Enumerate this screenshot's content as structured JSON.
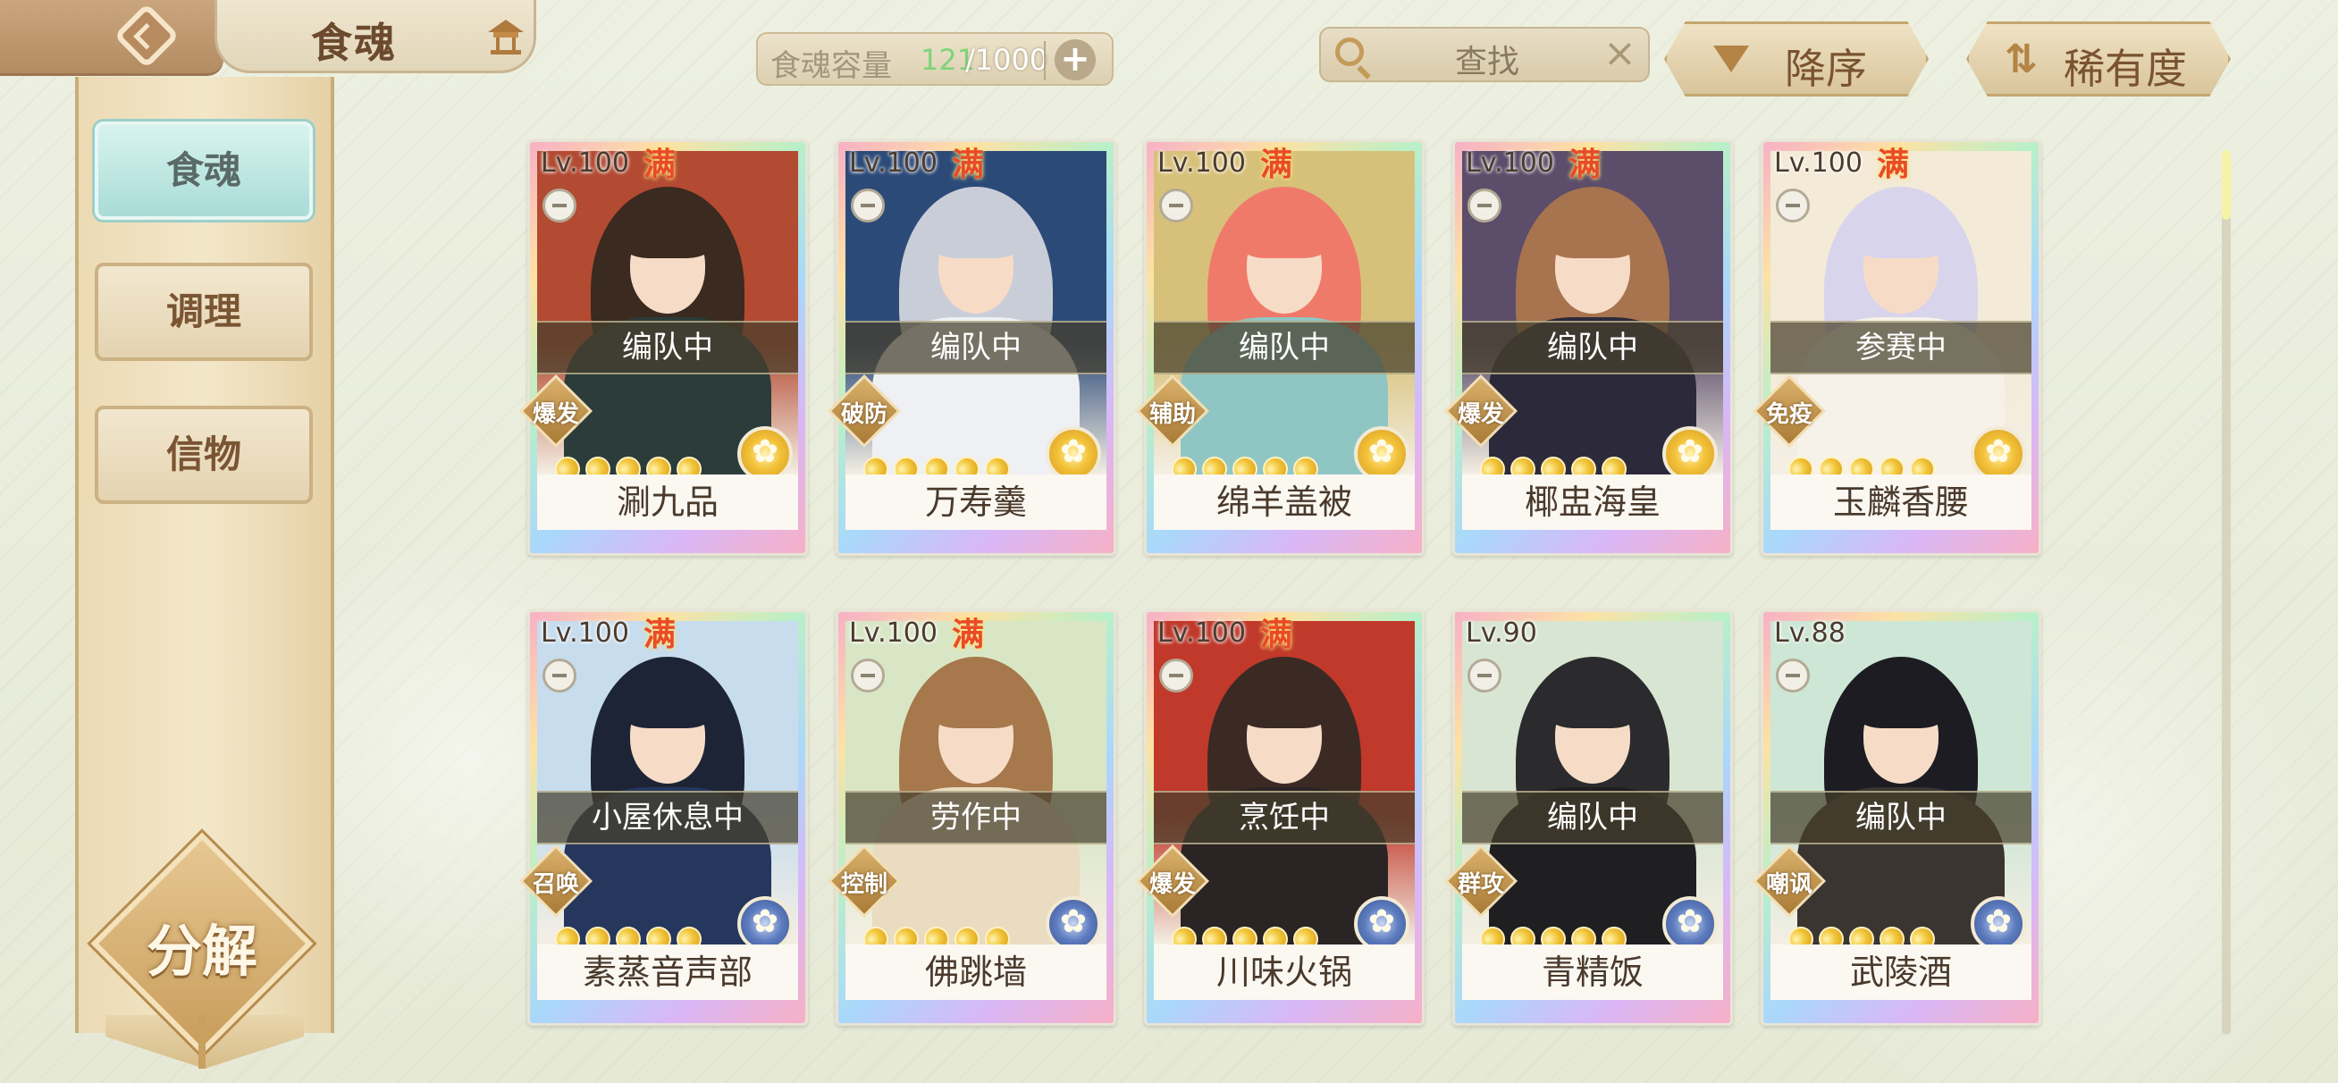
{
  "header": {
    "title": "食魂",
    "capacity": {
      "label": "食魂容量",
      "current": "121",
      "total": "/1000"
    },
    "search_placeholder": "查找",
    "sort_desc_label": "降序",
    "sort_rarity_label": "稀有度"
  },
  "sidebar": {
    "tabs": [
      {
        "label": "食魂",
        "active": true
      },
      {
        "label": "调理",
        "active": false
      },
      {
        "label": "信物",
        "active": false
      }
    ],
    "decompose_label": "分解"
  },
  "cards": [
    {
      "level": "Lv.100",
      "full": "满",
      "status": "编队中",
      "role": "爆发",
      "stars": 5,
      "element": "gold",
      "name": "涮九品",
      "art": {
        "bg": "#b34a32",
        "hair": "#3a2a20",
        "body": "#2b3c3a"
      }
    },
    {
      "level": "Lv.100",
      "full": "满",
      "status": "编队中",
      "role": "破防",
      "stars": 5,
      "element": "gold",
      "name": "万寿羹",
      "art": {
        "bg": "#2c4a78",
        "hair": "#c9cdd8",
        "body": "#eef0f3"
      }
    },
    {
      "level": "Lv.100",
      "full": "满",
      "status": "编队中",
      "role": "辅助",
      "stars": 5,
      "element": "gold",
      "name": "绵羊盖被",
      "art": {
        "bg": "#d7c17a",
        "hair": "#f07a6a",
        "body": "#8fc6c4"
      }
    },
    {
      "level": "Lv.100",
      "full": "满",
      "status": "编队中",
      "role": "爆发",
      "stars": 5,
      "element": "gold",
      "name": "椰盅海皇",
      "art": {
        "bg": "#5c4d6a",
        "hair": "#a7744f",
        "body": "#2c2a3a"
      }
    },
    {
      "level": "Lv.100",
      "full": "满",
      "status": "参赛中",
      "role": "免疫",
      "stars": 5,
      "element": "gold",
      "name": "玉麟香腰",
      "art": {
        "bg": "#f3ead7",
        "hair": "#d8d4ec",
        "body": "#f6f2ea"
      }
    },
    {
      "level": "Lv.100",
      "full": "满",
      "status": "小屋休息中",
      "role": "召唤",
      "stars": 5,
      "element": "blue",
      "name": "素蒸音声部",
      "art": {
        "bg": "#c7dced",
        "hair": "#1d2436",
        "body": "#26375e"
      }
    },
    {
      "level": "Lv.100",
      "full": "满",
      "status": "劳作中",
      "role": "控制",
      "stars": 5,
      "element": "blue",
      "name": "佛跳墙",
      "art": {
        "bg": "#d9e6c6",
        "hair": "#a6784c",
        "body": "#e9dcc0"
      }
    },
    {
      "level": "Lv.100",
      "full": "满",
      "status": "烹饪中",
      "role": "爆发",
      "stars": 5,
      "element": "blue",
      "name": "川味火锅",
      "art": {
        "bg": "#c0392b",
        "hair": "#3b2a24",
        "body": "#2a2424"
      }
    },
    {
      "level": "Lv.90",
      "full": "",
      "status": "编队中",
      "role": "群攻",
      "stars": 5,
      "element": "blue",
      "name": "青精饭",
      "art": {
        "bg": "#d8e5d2",
        "hair": "#2b2b2e",
        "body": "#1f1f22"
      }
    },
    {
      "level": "Lv.88",
      "full": "",
      "status": "编队中",
      "role": "嘲讽",
      "stars": 5,
      "element": "blue",
      "name": "武陵酒",
      "art": {
        "bg": "#cde6d6",
        "hair": "#1c1c22",
        "body": "#3a3530"
      }
    }
  ]
}
